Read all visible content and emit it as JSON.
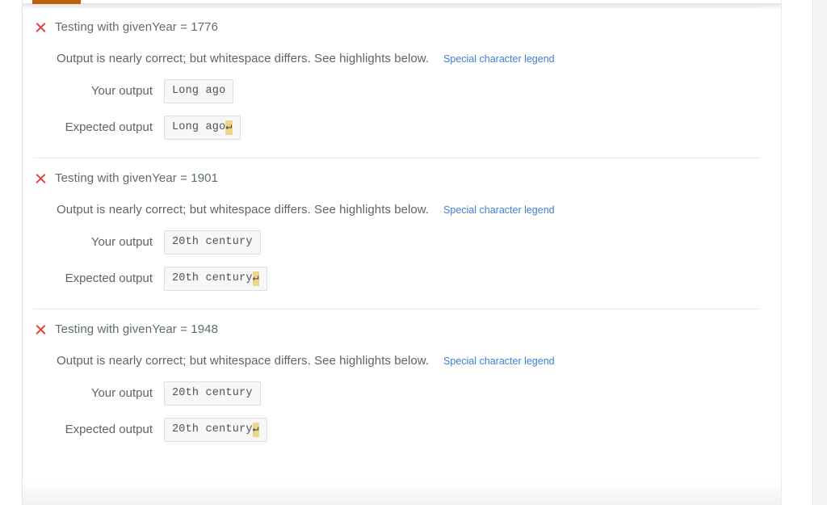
{
  "window": {
    "background_color": "#ffffff",
    "panel_background": "#f5f5f5"
  },
  "tabstrip": {
    "active_tab_indicator_color": "#bf5f10",
    "hairline_color": "#e8e8e8"
  },
  "colors": {
    "fail_icon": "#dc4338",
    "link": "#3d7fd6",
    "text": "#5c6569",
    "title": "#5f6b73",
    "highlight": "#ecd588",
    "box_background": "#f7f7f7",
    "box_border": "#dddddd"
  },
  "labels": {
    "your_output": "Your output",
    "expected_output": "Expected output",
    "legend_link": "Special character legend"
  },
  "icons": {
    "fail": "close-x-icon",
    "newline_glyph": "↵"
  },
  "test_cases": [
    {
      "status": "fail",
      "title": "Testing with givenYear = 1776",
      "message": "Output is nearly correct; but whitespace differs. See highlights below.",
      "legend_link": "Special character legend",
      "your_output": "Long ago",
      "expected_output_text": "Long ago",
      "expected_output_highlight": "↵"
    },
    {
      "status": "fail",
      "title": "Testing with givenYear = 1901",
      "message": "Output is nearly correct; but whitespace differs. See highlights below.",
      "legend_link": "Special character legend",
      "your_output": "20th century",
      "expected_output_text": "20th century",
      "expected_output_highlight": "↵"
    },
    {
      "status": "fail",
      "title": "Testing with givenYear = 1948",
      "message": "Output is nearly correct; but whitespace differs. See highlights below.",
      "legend_link": "Special character legend",
      "your_output": "20th century",
      "expected_output_text": "20th century",
      "expected_output_highlight": "↵"
    }
  ]
}
